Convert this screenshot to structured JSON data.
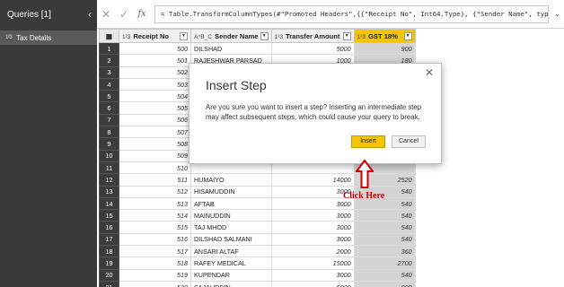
{
  "queries": {
    "title": "Queries [1]",
    "collapse_glyph": "‹",
    "items": [
      {
        "icon": "1²3",
        "label": "Tax Details"
      }
    ]
  },
  "formula_bar": {
    "cancel_glyph": "✕",
    "confirm_glyph": "✓",
    "fx_label": "fx",
    "formula": "= Table.TransformColumnTypes(#\"Promoted Headers\",{{\"Receipt No\", Int64.Type}, {\"Sender Name\", type",
    "expand_glyph": "⌄"
  },
  "grid": {
    "columns": [
      {
        "type_icon": "1²3",
        "label": "Receipt No"
      },
      {
        "type_icon": "A^B_C",
        "label": "Sender Name"
      },
      {
        "type_icon": "1²3",
        "label": "Transfer Amount"
      },
      {
        "type_icon": "1²3",
        "label": "GST 18%"
      }
    ],
    "rows": [
      {
        "n": "1",
        "receipt": "500",
        "sender": "DILSHAD",
        "amount": "5000",
        "gst": "900"
      },
      {
        "n": "2",
        "receipt": "501",
        "sender": "RAJESHWAR PARSAD",
        "amount": "1000",
        "gst": "180"
      },
      {
        "n": "3",
        "receipt": "502",
        "sender": "",
        "amount": "",
        "gst": ""
      },
      {
        "n": "4",
        "receipt": "503",
        "sender": "",
        "amount": "",
        "gst": ""
      },
      {
        "n": "5",
        "receipt": "504",
        "sender": "",
        "amount": "",
        "gst": ""
      },
      {
        "n": "6",
        "receipt": "505",
        "sender": "",
        "amount": "",
        "gst": ""
      },
      {
        "n": "7",
        "receipt": "506",
        "sender": "",
        "amount": "",
        "gst": ""
      },
      {
        "n": "8",
        "receipt": "507",
        "sender": "",
        "amount": "",
        "gst": ""
      },
      {
        "n": "9",
        "receipt": "508",
        "sender": "",
        "amount": "",
        "gst": ""
      },
      {
        "n": "10",
        "receipt": "509",
        "sender": "",
        "amount": "",
        "gst": ""
      },
      {
        "n": "11",
        "receipt": "510",
        "sender": "",
        "amount": "",
        "gst": ""
      },
      {
        "n": "12",
        "receipt": "511",
        "sender": "HUMAIYO",
        "amount": "14000",
        "gst": "2520"
      },
      {
        "n": "13",
        "receipt": "512",
        "sender": "HISAMUDDIN",
        "amount": "3000",
        "gst": "540"
      },
      {
        "n": "14",
        "receipt": "513",
        "sender": "AFTAB",
        "amount": "3000",
        "gst": "540"
      },
      {
        "n": "15",
        "receipt": "514",
        "sender": "MAINUDDIN",
        "amount": "3000",
        "gst": "540"
      },
      {
        "n": "16",
        "receipt": "515",
        "sender": "TAJ MHOD",
        "amount": "3000",
        "gst": "540"
      },
      {
        "n": "17",
        "receipt": "516",
        "sender": "DILSHAD SALMANI",
        "amount": "3000",
        "gst": "540"
      },
      {
        "n": "18",
        "receipt": "517",
        "sender": "ANSARI ALTAF",
        "amount": "2000",
        "gst": "360"
      },
      {
        "n": "19",
        "receipt": "518",
        "sender": "RAFEY MEDICAL",
        "amount": "15000",
        "gst": "2700"
      },
      {
        "n": "20",
        "receipt": "519",
        "sender": "KUPENDAR",
        "amount": "3000",
        "gst": "540"
      },
      {
        "n": "21",
        "receipt": "520",
        "sender": "SAJAUDDIN",
        "amount": "5000",
        "gst": "900"
      }
    ]
  },
  "dialog": {
    "title": "Insert Step",
    "close_glyph": "✕",
    "message": "Are you sure you want to insert a step? Inserting an intermediate step may affect subsequent steps, which could cause your query to break.",
    "insert_label": "Insert",
    "cancel_label": "Cancel"
  },
  "annotation": {
    "label": "Click Here",
    "color": "#c00000"
  },
  "colors": {
    "accent_yellow": "#f5c400",
    "pane_dark": "#3a3a3a"
  }
}
